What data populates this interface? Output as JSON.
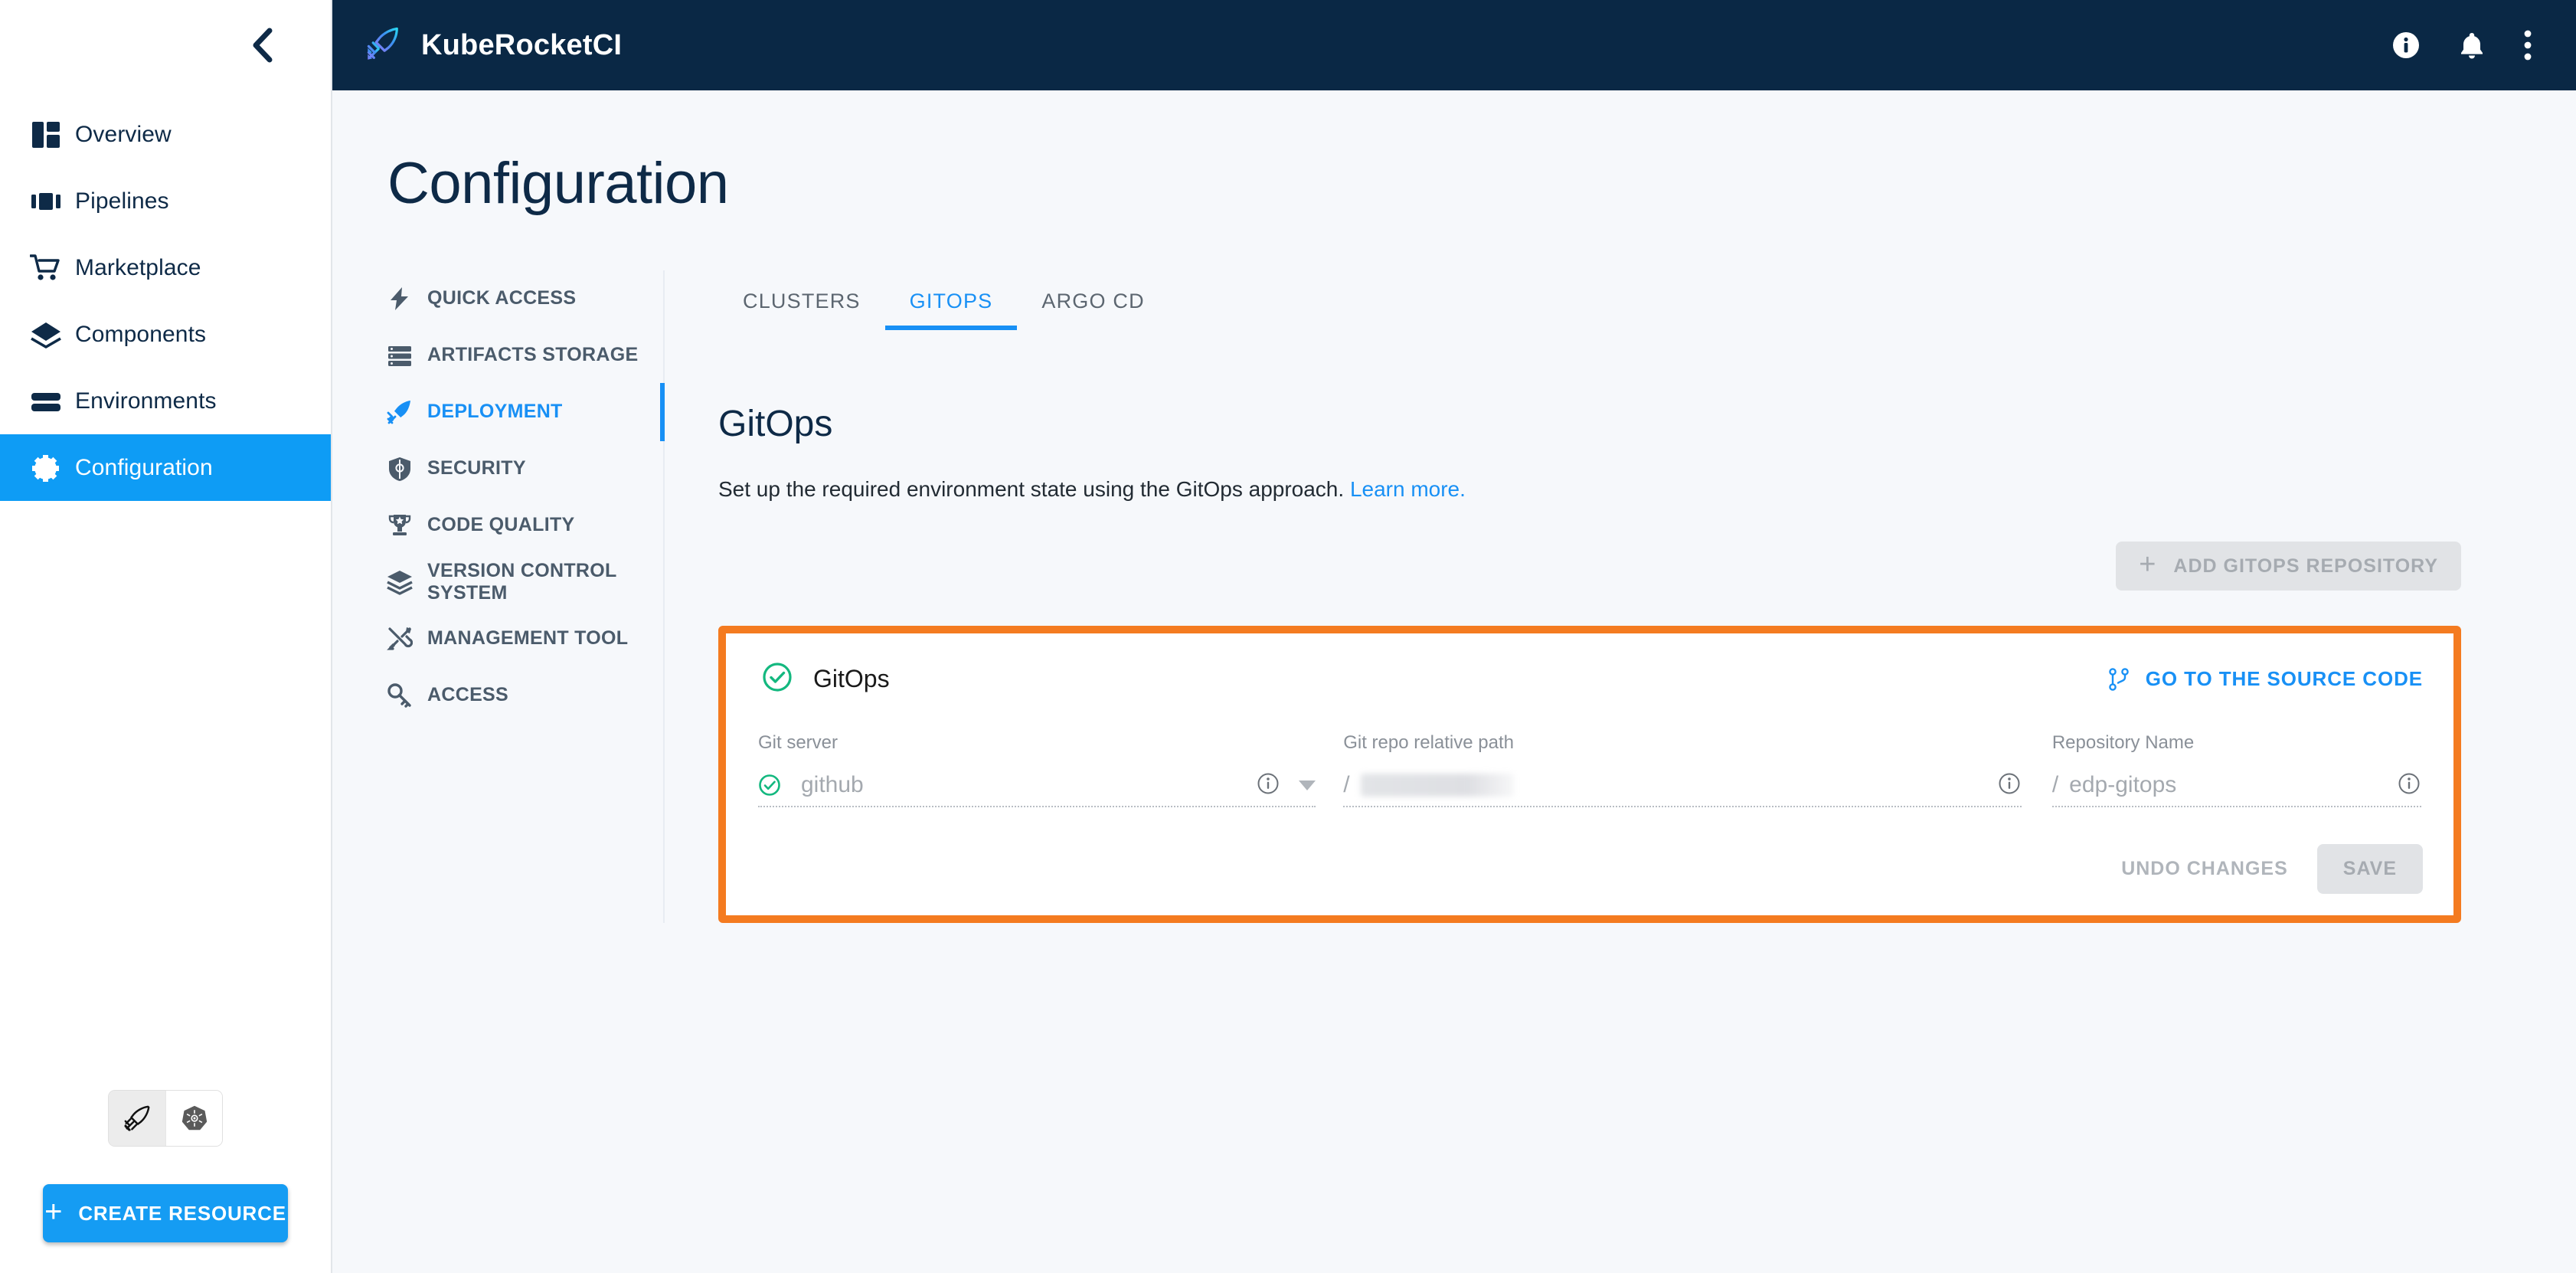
{
  "topbar": {
    "brand": "KubeRocketCI",
    "logo_icon": "rocket-logo-icon",
    "info_icon": "info-circle-icon",
    "notifications_icon": "bell-icon",
    "more_icon": "more-vertical-icon",
    "background": "#0a2845"
  },
  "sidebar": {
    "collapse_icon": "chevron-left-icon",
    "items": [
      {
        "label": "Overview",
        "icon": "dashboard-icon",
        "active": false
      },
      {
        "label": "Pipelines",
        "icon": "pipelines-icon",
        "active": false
      },
      {
        "label": "Marketplace",
        "icon": "cart-icon",
        "active": false
      },
      {
        "label": "Components",
        "icon": "layers-icon",
        "active": false
      },
      {
        "label": "Environments",
        "icon": "environments-icon",
        "active": false
      },
      {
        "label": "Configuration",
        "icon": "gear-icon",
        "active": true
      }
    ],
    "mode_toggle": [
      {
        "icon": "rocket-icon",
        "selected": true
      },
      {
        "icon": "kubernetes-icon",
        "selected": false
      }
    ],
    "create_button": {
      "label": "CREATE RESOURCE",
      "plus": "+",
      "color": "#159cf3"
    }
  },
  "page": {
    "title": "Configuration"
  },
  "settings_nav": {
    "items": [
      {
        "label": "QUICK ACCESS",
        "icon": "lightning-icon",
        "active": false
      },
      {
        "label": "ARTIFACTS STORAGE",
        "icon": "storage-icon",
        "active": false
      },
      {
        "label": "DEPLOYMENT",
        "icon": "rocket-icon",
        "active": true
      },
      {
        "label": "SECURITY",
        "icon": "shield-icon",
        "active": false
      },
      {
        "label": "CODE QUALITY",
        "icon": "trophy-icon",
        "active": false
      },
      {
        "label": "VERSION CONTROL SYSTEM",
        "icon": "layers-icon",
        "active": false
      },
      {
        "label": "MANAGEMENT TOOL",
        "icon": "tools-icon",
        "active": false
      },
      {
        "label": "ACCESS",
        "icon": "key-icon",
        "active": false
      }
    ],
    "accent": "#1890f5"
  },
  "main": {
    "tabs": [
      {
        "label": "CLUSTERS",
        "active": false
      },
      {
        "label": "GITOPS",
        "active": true
      },
      {
        "label": "ARGO CD",
        "active": false
      }
    ],
    "section": {
      "title": "GitOps",
      "description": "Set up the required environment state using the GitOps approach.",
      "link_label": "Learn more."
    },
    "add_button": {
      "label": "ADD GITOPS REPOSITORY",
      "plus": "+",
      "disabled": true
    },
    "card": {
      "highlight_color": "#f47b20",
      "status_icon": "check-circle-icon",
      "status_color": "#13b87f",
      "title": "GitOps",
      "source_link": {
        "label": "GO TO THE SOURCE CODE",
        "icon": "git-branch-icon"
      },
      "fields": [
        {
          "label": "Git server",
          "prefix": "",
          "value": "github",
          "has_check": true,
          "info_icon": "info-outline-icon",
          "has_caret": true,
          "redacted": false
        },
        {
          "label": "Git repo relative path",
          "prefix": "/",
          "value": "",
          "has_check": false,
          "info_icon": "info-outline-icon",
          "has_caret": false,
          "redacted": true
        },
        {
          "label": "Repository Name",
          "prefix": "/",
          "value": "edp-gitops",
          "has_check": false,
          "info_icon": "info-outline-icon",
          "has_caret": false,
          "redacted": false
        }
      ],
      "actions": {
        "undo_label": "UNDO CHANGES",
        "save_label": "SAVE"
      }
    }
  }
}
